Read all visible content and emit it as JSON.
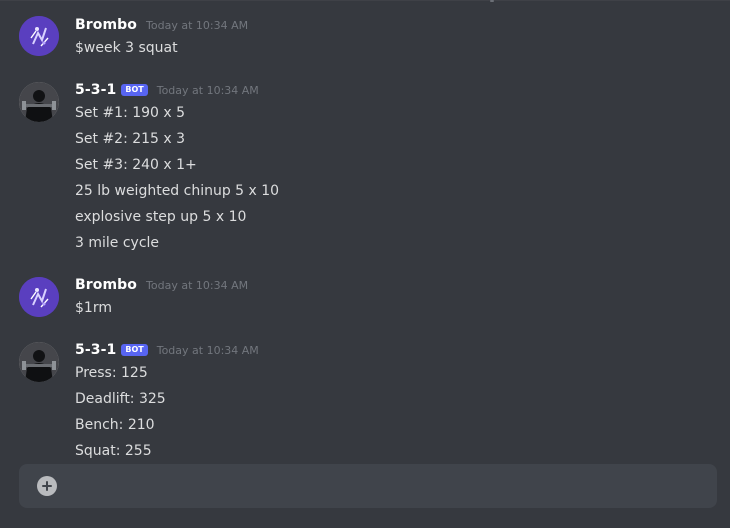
{
  "messages": [
    {
      "username": "Brombo",
      "bot": false,
      "avatar": "purple-figure-avatar",
      "timestamp": "Today at 10:34 AM",
      "lines": [
        "$week 3 squat"
      ]
    },
    {
      "username": "5-3-1",
      "bot": true,
      "bot_label": "BOT",
      "avatar": "dark-lifter-avatar",
      "timestamp": "Today at 10:34 AM",
      "lines": [
        "Set #1: 190 x 5",
        "Set #2: 215 x 3",
        "Set #3: 240 x 1+",
        "25 lb weighted chinup 5 x 10",
        "explosive step up 5 x 10",
        "3 mile cycle"
      ]
    },
    {
      "username": "Brombo",
      "bot": false,
      "avatar": "purple-figure-avatar",
      "timestamp": "Today at 10:34 AM",
      "lines": [
        "$1rm"
      ]
    },
    {
      "username": "5-3-1",
      "bot": true,
      "bot_label": "BOT",
      "avatar": "dark-lifter-avatar",
      "timestamp": "Today at 10:34 AM",
      "lines": [
        "Press: 125",
        "Deadlift: 325",
        "Bench: 210",
        "Squat: 255"
      ]
    }
  ],
  "composer": {
    "placeholder": "",
    "add_icon": "plus-circle-icon"
  },
  "colors": {
    "background": "#36393f",
    "username": "#ffffff",
    "message_text": "#dcddde",
    "timestamp": "#72767d",
    "bot_tag": "#5865f2",
    "composer": "#40444b"
  }
}
